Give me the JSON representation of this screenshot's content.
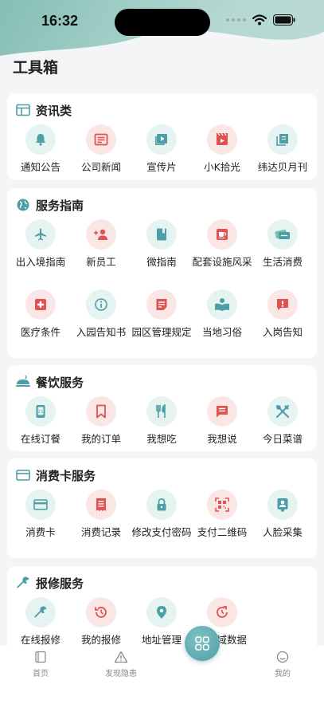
{
  "status": {
    "time": "16:32"
  },
  "page_title": "工具箱",
  "colors": {
    "teal": "#4d9ea6",
    "red": "#e05252",
    "teal_bg": "#e5f3f1",
    "red_bg": "#fbe6e6"
  },
  "sections": {
    "news": {
      "title": "资讯类",
      "items": [
        {
          "label": "通知公告",
          "icon": "bell-icon"
        },
        {
          "label": "公司新闻",
          "icon": "newspaper-icon"
        },
        {
          "label": "宣传片",
          "icon": "video-icon"
        },
        {
          "label": "小K拾光",
          "icon": "film-icon"
        },
        {
          "label": "纬达贝月刊",
          "icon": "magazine-icon"
        }
      ]
    },
    "guide": {
      "title": "服务指南",
      "items": [
        {
          "label": "出入境指南",
          "icon": "airplane-icon"
        },
        {
          "label": "新员工",
          "icon": "add-person-icon"
        },
        {
          "label": "微指南",
          "icon": "book-icon"
        },
        {
          "label": "配套设施风采",
          "icon": "coffee-icon"
        },
        {
          "label": "生活消费",
          "icon": "ticket-icon"
        },
        {
          "label": "医疗条件",
          "icon": "medical-icon"
        },
        {
          "label": "入园告知书",
          "icon": "info-icon"
        },
        {
          "label": "园区管理规定",
          "icon": "document-icon"
        },
        {
          "label": "当地习俗",
          "icon": "reading-icon"
        },
        {
          "label": "入岗告知",
          "icon": "alert-icon"
        }
      ]
    },
    "dining": {
      "title": "餐饮服务",
      "items": [
        {
          "label": "在线订餐",
          "icon": "phone-icon"
        },
        {
          "label": "我的订单",
          "icon": "bookmark-icon"
        },
        {
          "label": "我想吃",
          "icon": "utensils-icon"
        },
        {
          "label": "我想说",
          "icon": "message-icon"
        },
        {
          "label": "今日菜谱",
          "icon": "cutlery-icon"
        }
      ]
    },
    "card": {
      "title": "消费卡服务",
      "items": [
        {
          "label": "消费卡",
          "icon": "credit-card-icon"
        },
        {
          "label": "消费记录",
          "icon": "receipt-icon"
        },
        {
          "label": "修改支付密码",
          "icon": "lock-icon"
        },
        {
          "label": "支付二维码",
          "icon": "qr-code-icon"
        },
        {
          "label": "人脸采集",
          "icon": "face-id-icon"
        }
      ]
    },
    "repair": {
      "title": "报修服务",
      "items": [
        {
          "label": "在线报修",
          "icon": "wrench-icon"
        },
        {
          "label": "我的报修",
          "icon": "history-icon"
        },
        {
          "label": "地址管理",
          "icon": "location-icon"
        },
        {
          "label": "区域数据",
          "icon": "refresh-icon"
        }
      ]
    }
  },
  "tabbar": {
    "home": "首页",
    "hazard": "发现隐患",
    "mine": "我的"
  }
}
